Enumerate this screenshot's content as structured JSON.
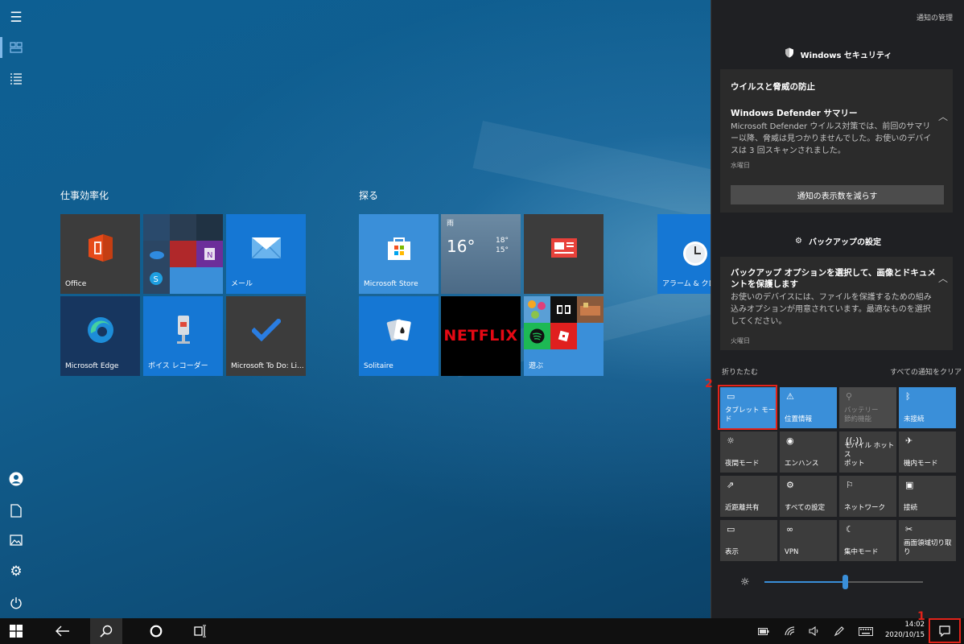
{
  "start": {
    "groups": [
      {
        "title": "仕事効率化"
      },
      {
        "title": "探る"
      }
    ],
    "tiles": {
      "office": "Office",
      "mail": "メール",
      "edge": "Microsoft Edge",
      "voice": "ボイス レコーダー",
      "todo": "Microsoft To Do: Li...",
      "store": "Microsoft Store",
      "weather": {
        "label": "雨",
        "temp": "16°",
        "high": "18°",
        "low": "15°"
      },
      "news": "",
      "alarm": "アラーム & クロック",
      "solitaire": "Solitaire",
      "netflix": "NETFLIX",
      "play": "遊ぶ"
    }
  },
  "action_center": {
    "manage_link": "通知の管理",
    "security_header": "Windows セキュリティ",
    "card1": {
      "title": "ウイルスと脅威の防止",
      "item_title": "Windows Defender サマリー",
      "body": "Microsoft Defender ウイルス対策では、前回のサマリー以降、脅威は見つかりませんでした。お使いのデバイスは 3 回スキャンされました。",
      "time": "水曜日",
      "button": "通知の表示数を減らす"
    },
    "backup_header": "バックアップの設定",
    "card2": {
      "title": "バックアップ オプションを選択して、画像とドキュメントを保護します",
      "body": "お使いのデバイスには、ファイルを保護するための組み込みオプションが用意されています。最適なものを選択してください。",
      "time": "火曜日"
    },
    "collapse": "折りたたむ",
    "clear_all": "すべての通知をクリア",
    "quick_actions": [
      {
        "label": "タブレット モード",
        "icon": "tablet-icon",
        "state": "on"
      },
      {
        "label": "位置情報",
        "icon": "location-icon",
        "state": "on"
      },
      {
        "label": "バッテリー\n節約機能",
        "icon": "battery-saver-icon",
        "state": "dim"
      },
      {
        "label": "未接続",
        "icon": "bluetooth-icon",
        "state": "on"
      },
      {
        "label": "夜間モード",
        "icon": "night-light-icon",
        "state": "off"
      },
      {
        "label": "エンハンス",
        "icon": "palette-icon",
        "state": "off"
      },
      {
        "label": "モバイル ホットス\nポット",
        "icon": "hotspot-icon",
        "state": "off"
      },
      {
        "label": "機内モード",
        "icon": "airplane-icon",
        "state": "off"
      },
      {
        "label": "近距離共有",
        "icon": "share-icon",
        "state": "off"
      },
      {
        "label": "すべての設定",
        "icon": "gear-icon",
        "state": "off"
      },
      {
        "label": "ネットワーク",
        "icon": "network-icon",
        "state": "off"
      },
      {
        "label": "接続",
        "icon": "connect-icon",
        "state": "off"
      },
      {
        "label": "表示",
        "icon": "project-icon",
        "state": "off"
      },
      {
        "label": "VPN",
        "icon": "vpn-icon",
        "state": "off"
      },
      {
        "label": "集中モード",
        "icon": "moon-icon",
        "state": "off"
      },
      {
        "label": "画面領域切り取\nり",
        "icon": "snip-icon",
        "state": "off"
      }
    ],
    "brightness_level": 0.51
  },
  "taskbar": {
    "time": "14:02",
    "date": "2020/10/15"
  },
  "annotations": {
    "marker1": "1",
    "marker2": "2"
  },
  "colors": {
    "accent": "#3a8fd9",
    "highlight": "#e2231a"
  }
}
